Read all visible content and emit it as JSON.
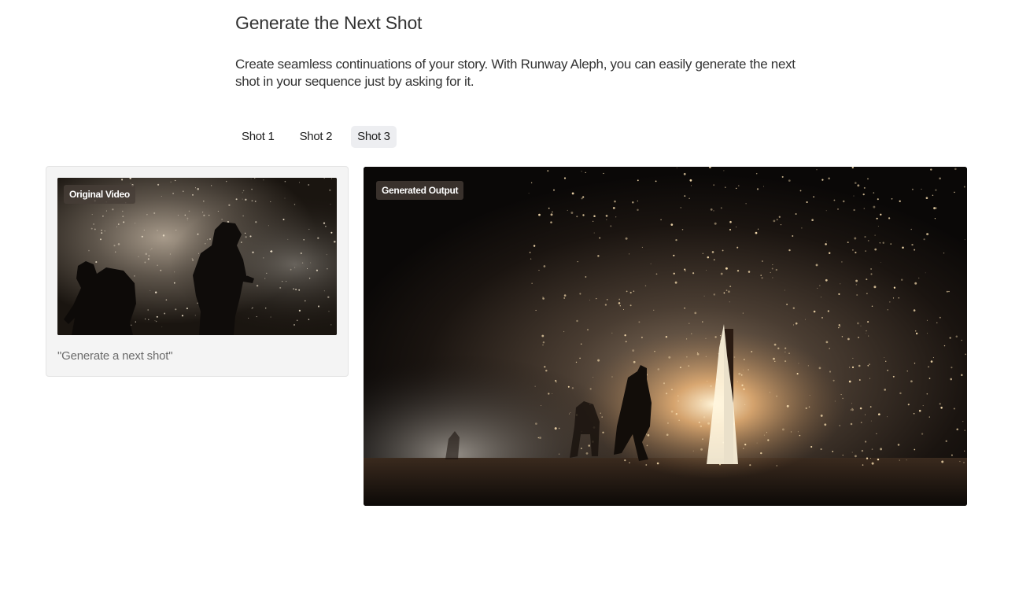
{
  "section": {
    "title": "Generate the Next Shot",
    "description": "Create seamless continuations of your story. With Runway Aleph, you can easily generate the next shot in your sequence just by asking for it."
  },
  "tabs": [
    {
      "label": "Shot 1",
      "active": false
    },
    {
      "label": "Shot 2",
      "active": false
    },
    {
      "label": "Shot 3",
      "active": true
    }
  ],
  "source": {
    "badge": "Original Video",
    "prompt": "\"Generate a next shot\""
  },
  "output": {
    "badge": "Generated Output"
  },
  "colors": {
    "active_tab_bg": "#edeef1",
    "card_bg": "#f4f4f4",
    "spark": "#f3d7a8"
  }
}
